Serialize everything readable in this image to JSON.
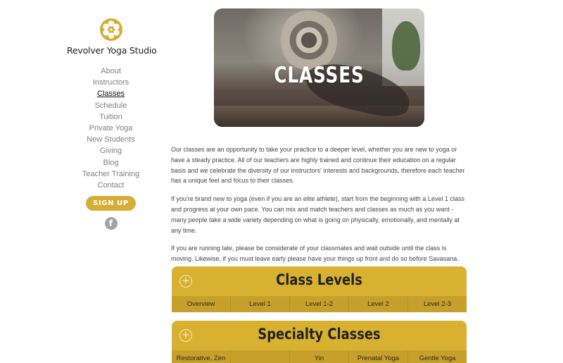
{
  "sidebar": {
    "logo": "film-reel-logo",
    "studio_name": "Revolver Yoga Studio",
    "nav": [
      {
        "label": "About",
        "active": false
      },
      {
        "label": "Instructors",
        "active": false
      },
      {
        "label": "Classes",
        "active": true
      },
      {
        "label": "Schedule",
        "active": false
      },
      {
        "label": "Tuition",
        "active": false
      },
      {
        "label": "Private Yoga",
        "active": false
      },
      {
        "label": "New Students",
        "active": false
      },
      {
        "label": "Giving",
        "active": false
      },
      {
        "label": "Blog",
        "active": false
      },
      {
        "label": "Teacher Training",
        "active": false
      },
      {
        "label": "Contact",
        "active": false
      }
    ],
    "signup_label": "SIGN UP",
    "facebook_glyph": "f"
  },
  "hero": {
    "title": "CLASSES"
  },
  "content": {
    "paragraphs": [
      "Our classes are an opportunity to take your practice to a deeper level, whether you are new to yoga or have a steady practice. All of our teachers are highly trained and continue their education on a regular basis and we celebrate the diversity of our instructors' interests and backgrounds, therefore each teacher has a unique feel and focus to their classes.",
      "If you're brand new to yoga (even if you are an elite athlete), start from the beginning with a Level 1 class and progress at your own pace. You can mix and match teachers and classes as much as you want - many people take a wide variety depending on what is going on physically, emotionally, and mentally at any time.",
      "If you are running late, please be considerate of your classmates and wait outside until the class is moving. Likewise, if you must leave early please have your things up front and do so before Savasana."
    ]
  },
  "accordions": [
    {
      "title": "Class Levels",
      "tabs": [
        "Overview",
        "Level 1",
        "Level 1-2",
        "Level 2",
        "Level 2-3"
      ]
    },
    {
      "title": "Specialty Classes",
      "tabs": [
        "Restorative, Zen",
        "",
        "Yin",
        "Prenatal Yoga",
        "Gentle Yoga"
      ]
    }
  ],
  "colors": {
    "accent": "#d8b131",
    "tab_bar": "#c6a02a",
    "button": "#d4ae36"
  },
  "icons": {
    "expand": "plus-circle-icon",
    "social": "facebook-icon"
  }
}
